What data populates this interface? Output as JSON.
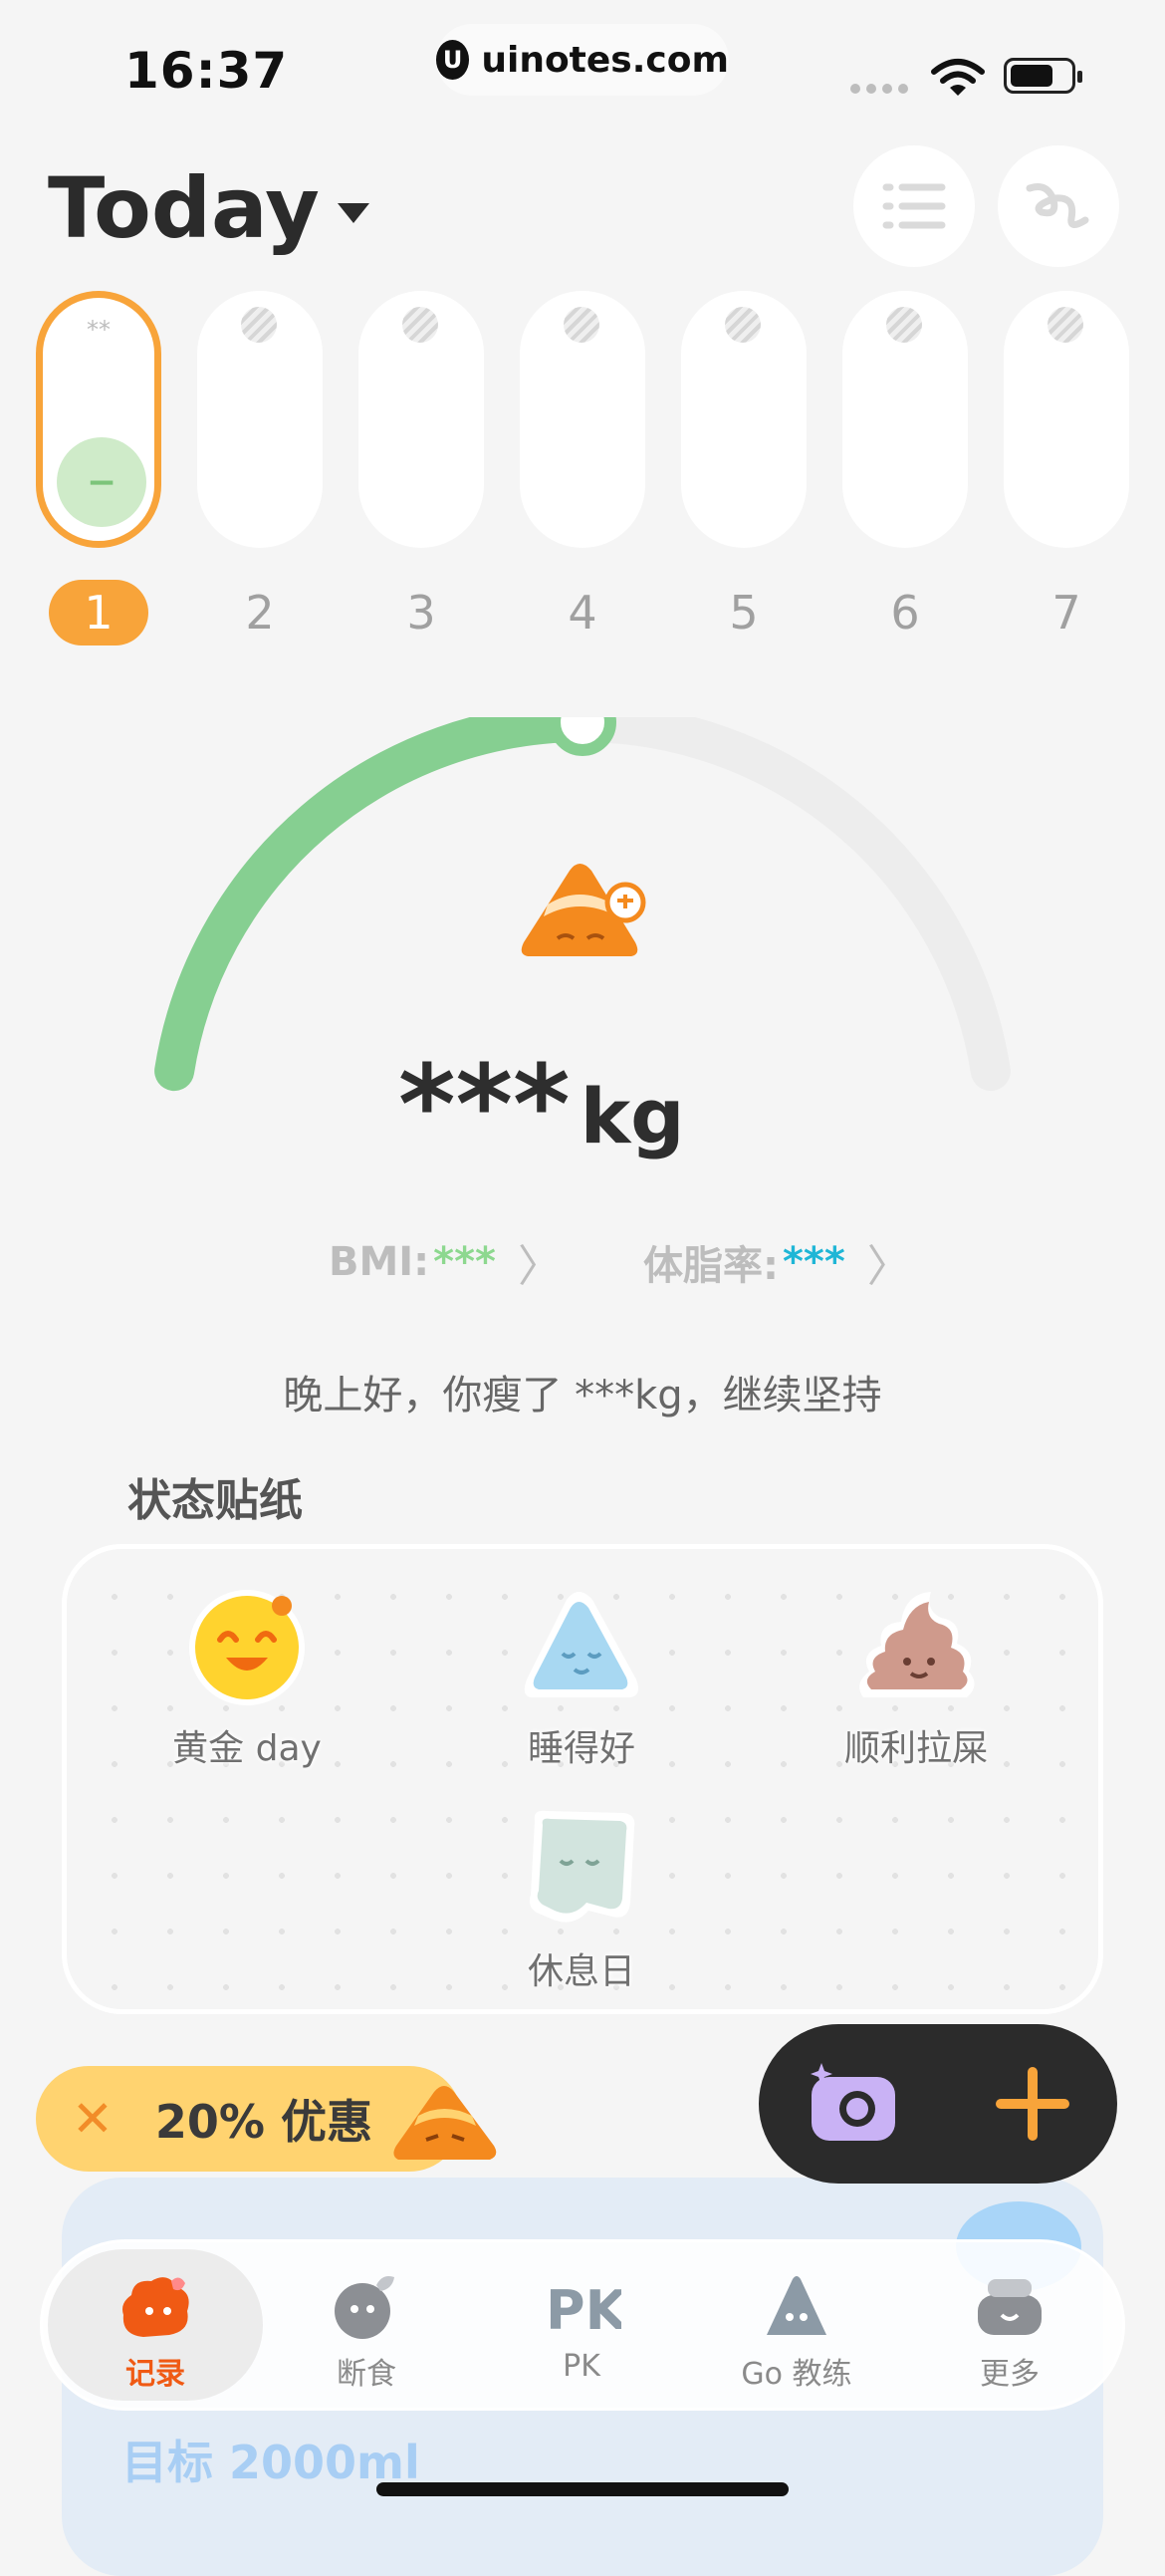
{
  "status_bar": {
    "time": "16:37",
    "url": "uinotes.com",
    "url_logo": "U"
  },
  "header": {
    "title": "Today"
  },
  "days": [
    {
      "num": "1",
      "stars": "**",
      "mark": "−",
      "active": true
    },
    {
      "num": "2"
    },
    {
      "num": "3"
    },
    {
      "num": "4"
    },
    {
      "num": "5"
    },
    {
      "num": "6"
    },
    {
      "num": "7"
    }
  ],
  "gauge": {
    "progress": 0.5,
    "color": "#86CF91",
    "track": "#EDEDED"
  },
  "weight": {
    "value": "***",
    "unit": "kg"
  },
  "metrics": {
    "bmi_label": "BMI:",
    "bmi_value": "***",
    "fat_label": "体脂率:",
    "fat_value": "***"
  },
  "greeting": "晚上好，你瘦了 ***kg，继续坚持",
  "stickers": {
    "title": "状态贴纸",
    "items": [
      "黄金 day",
      "睡得好",
      "顺利拉屎",
      "休息日"
    ]
  },
  "promo": {
    "close": "✕",
    "text": "20% 优惠"
  },
  "water": {
    "goal": "目标 2000ml"
  },
  "tabs": [
    "记录",
    "断食",
    "PK",
    "Go 教练",
    "更多"
  ],
  "colors": {
    "accent": "#F8A43A",
    "active_tab": "#F05A14",
    "gauge": "#86CF91"
  }
}
